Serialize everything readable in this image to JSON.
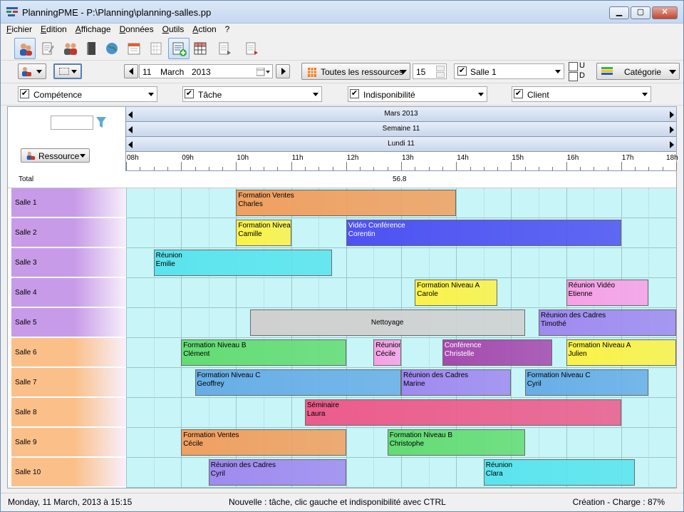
{
  "window": {
    "title": "PlanningPME - P:\\Planning\\planning-salles.pp",
    "minimize": "▁",
    "maximize": "▢",
    "close": "✕"
  },
  "menu": [
    "Fichier",
    "Edition",
    "Affichage",
    "Données",
    "Outils",
    "Action",
    "?"
  ],
  "toolbar": {
    "icons": [
      "resources-view-icon",
      "task-view-icon",
      "users-icon",
      "book-icon",
      "globe-icon",
      "calendar-icon",
      "month-view-icon",
      "add-task-icon",
      "table-icon",
      "list-export-icon",
      "list-print-icon"
    ]
  },
  "filters": {
    "day": "11",
    "month": "March",
    "year": "2013",
    "resource_filter": "Toutes les ressources",
    "count": "15",
    "room": "Salle 1",
    "room_checked": true,
    "u_label": "U",
    "d_label": "D",
    "category": "Catégorie",
    "competence": "Compétence",
    "tache": "Tâche",
    "indisponibilite": "Indisponibilité",
    "client": "Client"
  },
  "planner": {
    "month_header": "Mars 2013",
    "week_header": "Semaine 11",
    "day_header": "Lundi 11",
    "resource_button": "Ressource",
    "hours": [
      "08h",
      "09h",
      "10h",
      "11h",
      "12h",
      "13h",
      "14h",
      "15h",
      "16h",
      "17h",
      "18h"
    ],
    "total_label": "Total",
    "total_value": "56.8",
    "rows": [
      {
        "label": "Salle 1",
        "color": "#c89be8"
      },
      {
        "label": "Salle 2",
        "color": "#c89be8"
      },
      {
        "label": "Salle 3",
        "color": "#c89be8"
      },
      {
        "label": "Salle 4",
        "color": "#c89be8"
      },
      {
        "label": "Salle 5",
        "color": "#c89be8"
      },
      {
        "label": "Salle 6",
        "color": "#fbc08a"
      },
      {
        "label": "Salle 7",
        "color": "#fbc08a"
      },
      {
        "label": "Salle 8",
        "color": "#fbc08a"
      },
      {
        "label": "Salle 9",
        "color": "#fbc08a"
      },
      {
        "label": "Salle 10",
        "color": "#fbc08a"
      }
    ],
    "tasks": [
      {
        "row": 0,
        "start": 10.0,
        "end": 14.0,
        "title": "Formation Ventes",
        "person": "Charles",
        "color": "#f0a060"
      },
      {
        "row": 1,
        "start": 10.0,
        "end": 11.0,
        "title": "Formation Niveau A",
        "person": "Camille",
        "color": "#fbf248"
      },
      {
        "row": 1,
        "start": 12.0,
        "end": 17.0,
        "title": "Vidéo Conférence",
        "person": "Corentin",
        "color": "#4e52f2",
        "light": true
      },
      {
        "row": 2,
        "start": 8.5,
        "end": 11.75,
        "title": "Réunion",
        "person": "Emilie",
        "color": "#5ae4ee"
      },
      {
        "row": 3,
        "start": 13.25,
        "end": 14.75,
        "title": "Formation Niveau A",
        "person": "Carole",
        "color": "#fbf248"
      },
      {
        "row": 3,
        "start": 16.0,
        "end": 17.5,
        "title": "Réunion Vidéo",
        "person": "Etienne",
        "color": "#f7a0e6"
      },
      {
        "row": 4,
        "start": 10.25,
        "end": 15.25,
        "title": "Nettoyage",
        "person": "",
        "color": "#d0d0d0",
        "center": true
      },
      {
        "row": 4,
        "start": 15.5,
        "end": 18.0,
        "title": "Réunion des Cadres",
        "person": "Timothé",
        "color": "#a08af0"
      },
      {
        "row": 5,
        "start": 9.0,
        "end": 12.0,
        "title": "Formation Niveau B",
        "person": "Clément",
        "color": "#64dc74"
      },
      {
        "row": 5,
        "start": 12.5,
        "end": 13.0,
        "title": "Réunion des Cadres",
        "person": "Cécile",
        "color": "#f7a0e6"
      },
      {
        "row": 5,
        "start": 13.75,
        "end": 15.75,
        "title": "Conférence",
        "person": "Christelle",
        "color": "#a64aae",
        "light": true
      },
      {
        "row": 5,
        "start": 16.0,
        "end": 18.0,
        "title": "Formation Niveau A",
        "person": "Julien",
        "color": "#fbf248"
      },
      {
        "row": 6,
        "start": 9.25,
        "end": 13.0,
        "title": "Formation Niveau C",
        "person": "Geoffrey",
        "color": "#68aee6"
      },
      {
        "row": 6,
        "start": 13.0,
        "end": 15.0,
        "title": "Réunion des Cadres",
        "person": "Marine",
        "color": "#a08af0"
      },
      {
        "row": 6,
        "start": 15.25,
        "end": 17.5,
        "title": "Formation Niveau C",
        "person": "Cyril",
        "color": "#68aee6"
      },
      {
        "row": 7,
        "start": 11.25,
        "end": 17.0,
        "title": "Séminaire",
        "person": "Laura",
        "color": "#ec5c8c"
      },
      {
        "row": 8,
        "start": 9.0,
        "end": 12.0,
        "title": "Formation Ventes",
        "person": "Cécile",
        "color": "#f0a060"
      },
      {
        "row": 8,
        "start": 12.75,
        "end": 15.25,
        "title": "Formation Niveau B",
        "person": "Christophe",
        "color": "#64dc74"
      },
      {
        "row": 9,
        "start": 9.5,
        "end": 12.0,
        "title": "Réunion des Cadres",
        "person": "Cyril",
        "color": "#a08af0"
      },
      {
        "row": 9,
        "start": 14.5,
        "end": 17.25,
        "title": "Réunion",
        "person": "Clara",
        "color": "#5ae4ee"
      }
    ]
  },
  "status": {
    "left": "Monday, 11 March, 2013 à 15:15",
    "center": "Nouvelle : tâche, clic gauche et indisponibilité avec CTRL",
    "right": "Création - Charge : 87%"
  }
}
